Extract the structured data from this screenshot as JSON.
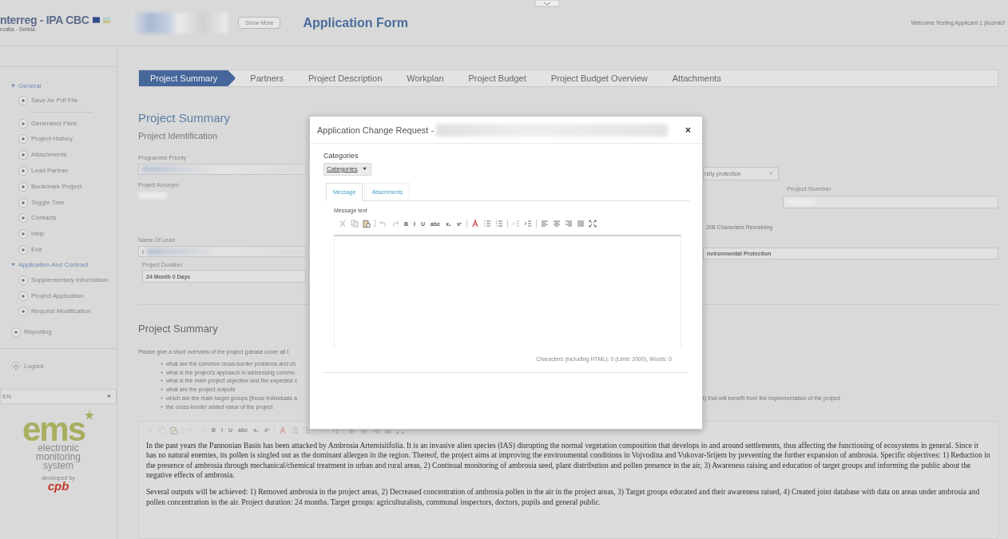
{
  "header": {
    "logo_title": "nterreg - IPA CBC",
    "logo_subtitle": "roatia - Serbia",
    "show_more_button": "Show More",
    "title": "Application Form",
    "welcome": "Welcome Testing Applicant 1 (kuzmicf"
  },
  "sidebar": {
    "sections": [
      {
        "label": "General",
        "expanded": true,
        "groups": [
          [
            "Save As Pdf File"
          ],
          [
            "Generated Files",
            "Project History",
            "Attachments",
            "Lead Partner",
            "Bookmark Project",
            "Toggle Tree",
            "Contacts",
            "Help",
            "Exit"
          ]
        ]
      },
      {
        "label": "Application And Contract",
        "expanded": true,
        "groups": [
          [
            "Supplementary Information",
            "Project Application",
            "Request Modification"
          ]
        ]
      }
    ],
    "reporting": "Reporting",
    "logout": "Logout",
    "language": "EN",
    "brand": {
      "logo": "ems",
      "tagline": "electronic monitoring system",
      "developer_label": "developed by",
      "developer": "cpb"
    }
  },
  "steps": [
    {
      "label": "Project Summary",
      "selected": true
    },
    {
      "label": "Partners",
      "selected": false
    },
    {
      "label": "Project Description",
      "selected": false
    },
    {
      "label": "Workplan",
      "selected": false
    },
    {
      "label": "Project Budget",
      "selected": false
    },
    {
      "label": "Project Budget Overview",
      "selected": false
    },
    {
      "label": "Attachments",
      "selected": false
    }
  ],
  "form": {
    "heading": "Project Summary",
    "subheading": "Project Identification",
    "programme_priority_label": "Programme Priority",
    "project_acronym_label": "Project Acronym",
    "name_of_lead_label": "Name Of Lead",
    "name_of_lead_value": "I",
    "project_duration_label": "Project Duration",
    "project_duration_value": "24 Month 0 Days",
    "priority_select_value": "rsity protection",
    "project_number_label": "Project Number",
    "characters_remaining": "208 Characters Remaining",
    "lead_field_value": "nvironmental Protection"
  },
  "summary": {
    "heading": "Project Summary",
    "intro": "Please give a short overview of the project (please cover all t",
    "bullets": [
      {
        "text": "what are the common cross-border problems and ch"
      },
      {
        "text": "what is the project's approach in addressing commo"
      },
      {
        "text": "what is the main project objective and the expected c"
      },
      {
        "text": "what are the project outputs"
      },
      {
        "text": "which are the main target groups (those individuals a",
        "tail": "t) that will benefit from the implementation of the project"
      },
      {
        "text": "the cross-border added value of the project"
      }
    ],
    "format_buttons": [
      "B",
      "I",
      "U",
      "abc",
      "x₁",
      "x¹"
    ],
    "paragraphs": [
      "In the past years the Pannonian Basin has been attacked by Ambrosia Artemisiifolia. It is an invasive alien species (IAS) disrupting the normal vegetation composition that develops in and around settlements, thus affecting the functioning of ecosystems in general. Since it has no natural enemies, its pollen is singled out as the dominant allergen in the region. Thereof, the project aims at improving the environmental conditions in Vojvodina and Vukovar-Srijem by preventing the further expansion of ambrosia. Specific objectives: 1) Reduction in the presence of ambrosia through mechanical/chemical treatment in urban and rural areas, 2) Continual monitoring of ambrosia seed, plant distribution and pollen presence in the air, 3) Awareness raising and education of target groups and informing the public about the negative effects of ambrosia.",
      "Several outputs will be achieved: 1) Removed ambrosia in the project areas, 2) Decreased concentration of ambrosia pollen in the air in the project areas, 3) Target groups educated and their awareness raised, 4) Created joint database with data on areas under ambrosia and pollen concentration in the air. Project duration: 24 months. Target groups: agriculturalists, communal inspectors, doctors, pupils and general public."
    ]
  },
  "modal": {
    "title": "Application Change Request -",
    "close": "×",
    "categories_label": "Categories",
    "categories_button": "Categories",
    "tabs": [
      {
        "label": "Message",
        "selected": true
      },
      {
        "label": "Attachments",
        "selected": false
      }
    ],
    "message_label": "Message text",
    "format_buttons": [
      "B",
      "I",
      "U",
      "abc",
      "x₁",
      "x¹"
    ],
    "counter": "Characters (including HTML): 0 (Limit: 2000), Words: 0"
  }
}
